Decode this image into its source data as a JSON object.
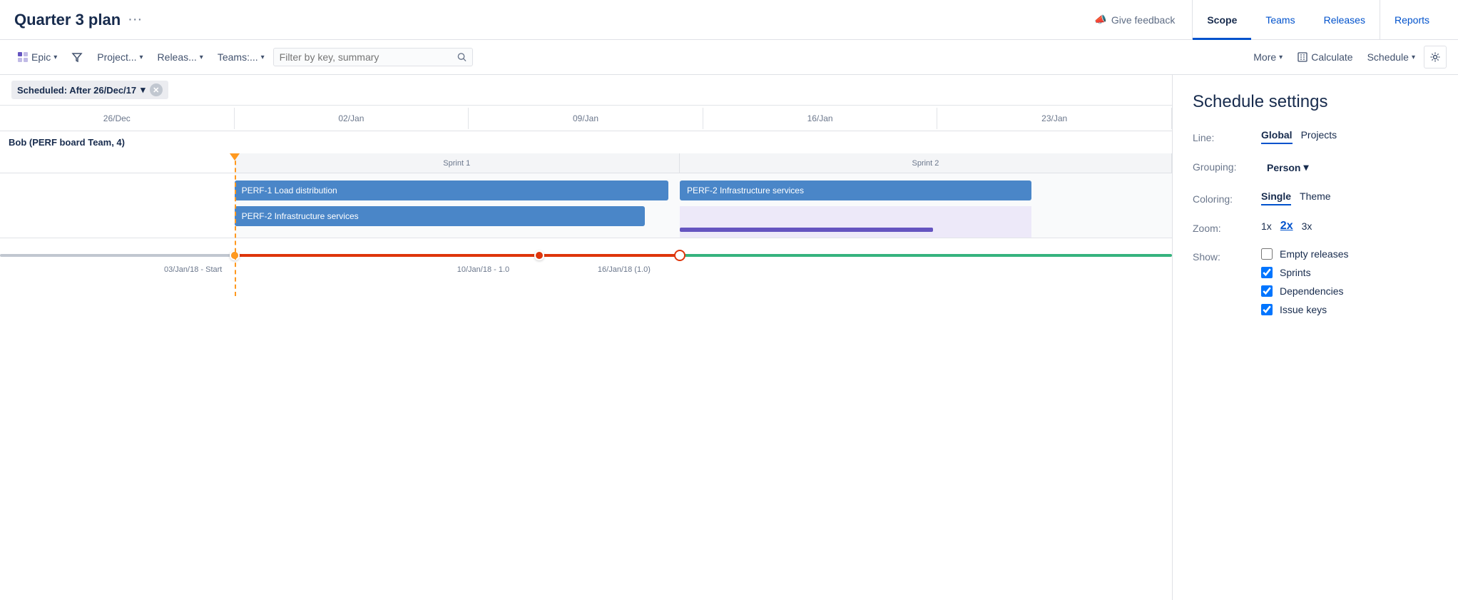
{
  "page": {
    "title": "Quarter 3 plan",
    "title_dots": "···"
  },
  "nav": {
    "feedback_icon": "📣",
    "feedback_label": "Give feedback",
    "tabs": [
      {
        "id": "scope",
        "label": "Scope",
        "active": true
      },
      {
        "id": "teams",
        "label": "Teams",
        "active": false
      },
      {
        "id": "releases",
        "label": "Releases",
        "active": false
      },
      {
        "id": "reports",
        "label": "Reports",
        "active": false
      }
    ]
  },
  "toolbar": {
    "epic_label": "Epic",
    "project_label": "Project...",
    "releases_label": "Releas...",
    "teams_label": "Teams:...",
    "search_placeholder": "Filter by key, summary",
    "more_label": "More",
    "calculate_label": "Calculate",
    "schedule_label": "Schedule"
  },
  "filter": {
    "label": "Scheduled: After 26/Dec/17"
  },
  "timeline": {
    "dates": [
      "26/Dec",
      "02/Jan",
      "09/Jan",
      "16/Jan",
      "23/Jan"
    ]
  },
  "gantt": {
    "team_label": "Bob (PERF board Team, 4)",
    "sprint1_label": "Sprint 1",
    "sprint2_label": "Sprint 2",
    "bar1_label": "PERF-1 Load distribution",
    "bar2_label": "PERF-2 Infrastructure services",
    "bar3_label": "PERF-2 Infrastructure services",
    "velocity": {
      "label1": "03/Jan/18 - Start",
      "label2": "10/Jan/18 - 1.0",
      "label3": "16/Jan/18 (1.0)"
    }
  },
  "settings": {
    "title": "Schedule settings",
    "line_label": "Line:",
    "line_global": "Global",
    "line_projects": "Projects",
    "grouping_label": "Grouping:",
    "grouping_value": "Person",
    "coloring_label": "Coloring:",
    "coloring_single": "Single",
    "coloring_theme": "Theme",
    "zoom_label": "Zoom:",
    "zoom_1x": "1x",
    "zoom_2x": "2x",
    "zoom_3x": "3x",
    "show_label": "Show:",
    "show_items": [
      {
        "label": "Empty releases",
        "checked": false
      },
      {
        "label": "Sprints",
        "checked": true
      },
      {
        "label": "Dependencies",
        "checked": true
      },
      {
        "label": "Issue keys",
        "checked": true
      }
    ]
  }
}
